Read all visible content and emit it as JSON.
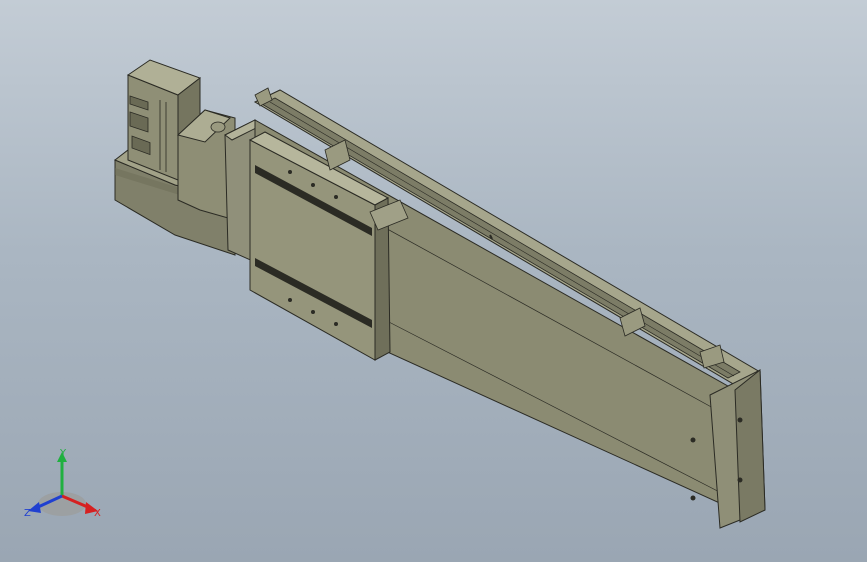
{
  "view": {
    "background_top": "#c3ccd5",
    "background_bottom": "#9aa6b3",
    "model_color": "#8b8b72",
    "model_dark": "#5a5a48",
    "edge_color": "#2b2b24"
  },
  "triad": {
    "x_label": "X",
    "y_label": "Y",
    "z_label": "Z",
    "x_color": "#d62020",
    "y_color": "#20b040",
    "z_color": "#2040d0"
  }
}
